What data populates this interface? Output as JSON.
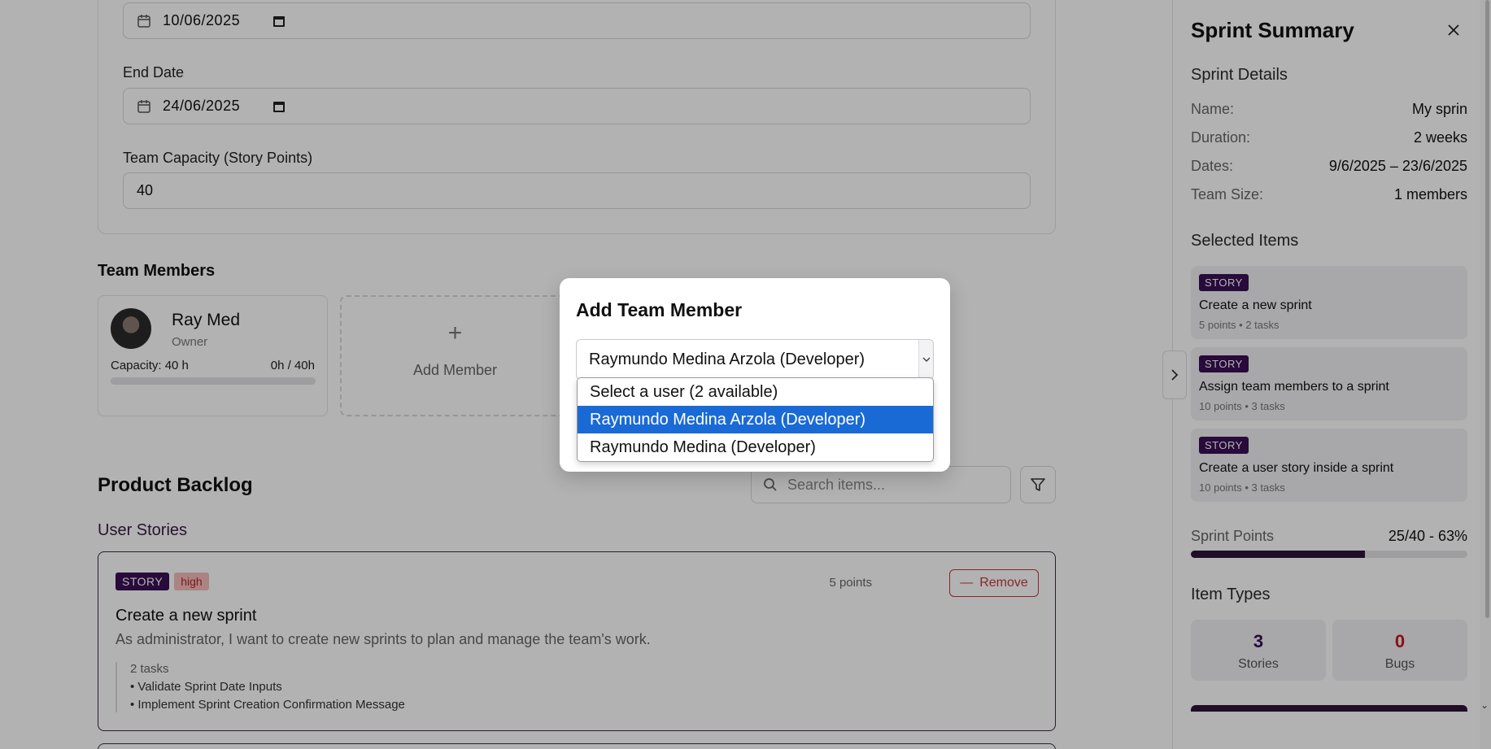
{
  "form": {
    "start_date": "10/06/2025",
    "end_date_label": "End Date",
    "end_date": "24/06/2025",
    "capacity_label": "Team Capacity (Story Points)",
    "capacity_value": "40"
  },
  "team": {
    "title": "Team Members",
    "member": {
      "name": "Ray Med",
      "role": "Owner",
      "capacity_label": "Capacity: 40 h",
      "hours": "0h / 40h",
      "usage_fraction": 0
    },
    "add_label": "Add Member",
    "add_plus": "+"
  },
  "backlog": {
    "title": "Product Backlog",
    "search_placeholder": "Search items...",
    "subtitle": "User Stories",
    "card": {
      "badge": "STORY",
      "priority": "high",
      "points": "5 points",
      "remove_label": "Remove",
      "title": "Create a new sprint",
      "description": "As administrator, I want to create new sprints to plan and manage the team's work.",
      "task_count": "2 tasks",
      "tasks": [
        "• Validate Sprint Date Inputs",
        "• Implement Sprint Creation Confirmation Message"
      ]
    }
  },
  "sidebar": {
    "title": "Sprint Summary",
    "details_title": "Sprint Details",
    "details": [
      {
        "key": "Name:",
        "value": "My sprin"
      },
      {
        "key": "Duration:",
        "value": "2 weeks"
      },
      {
        "key": "Dates:",
        "value": "9/6/2025 – 23/6/2025"
      },
      {
        "key": "Team Size:",
        "value": "1 members"
      }
    ],
    "selected_title": "Selected Items",
    "items": [
      {
        "badge": "STORY",
        "title": "Create a new sprint",
        "meta": "5 points • 2 tasks"
      },
      {
        "badge": "STORY",
        "title": "Assign team members to a sprint",
        "meta": "10 points • 3 tasks"
      },
      {
        "badge": "STORY",
        "title": "Create a user story inside a sprint",
        "meta": "10 points • 3 tasks"
      }
    ],
    "points_label": "Sprint Points",
    "points_value": "25/40 - 63%",
    "points_fraction": 0.63,
    "types_title": "Item Types",
    "types": [
      {
        "count": "3",
        "label": "Stories",
        "color": "#3a0f55"
      },
      {
        "count": "0",
        "label": "Bugs",
        "color": "#c4161c"
      }
    ]
  },
  "modal": {
    "title": "Add Team Member",
    "selected_value": "Raymundo Medina Arzola (Developer)",
    "options": [
      {
        "label": "Select a user (2 available)",
        "selected": false
      },
      {
        "label": "Raymundo Medina Arzola (Developer)",
        "selected": true
      },
      {
        "label": "Raymundo Medina (Developer)",
        "selected": false
      }
    ]
  },
  "colors": {
    "primary": "#2e1537",
    "story_badge": "#3a0f55",
    "danger": "#c7373d",
    "highlight": "#1a6ad6"
  },
  "icons": [
    "calendar-icon",
    "search-icon",
    "filter-icon",
    "close-icon",
    "chevron-right-icon",
    "chevron-down-icon",
    "minus-icon",
    "plus-icon"
  ]
}
